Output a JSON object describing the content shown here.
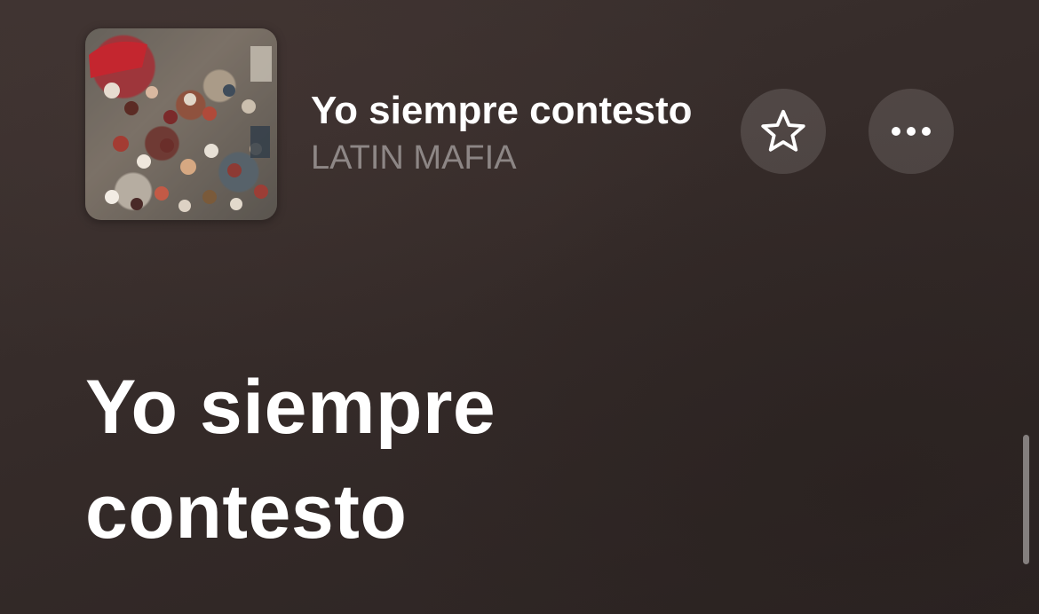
{
  "now_playing": {
    "title": "Yo siempre contesto",
    "artist": "LATIN MAFIA",
    "artwork_icon": "album-artwork-crowd-photo"
  },
  "actions": {
    "favorite_icon": "star-outline-icon",
    "more_icon": "ellipsis-icon"
  },
  "lyrics": {
    "lines": [
      "Yo siempre",
      "contesto"
    ]
  },
  "colors": {
    "background": "#352b29",
    "text_primary": "#ffffff",
    "text_secondary": "rgba(255,255,255,0.42)",
    "button_fill": "rgba(255,255,255,0.13)"
  }
}
